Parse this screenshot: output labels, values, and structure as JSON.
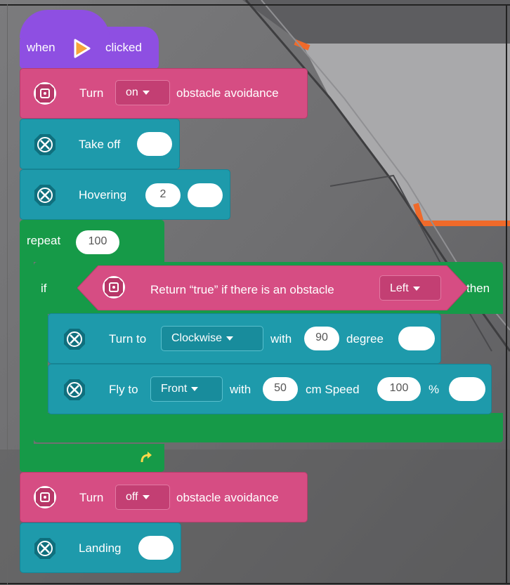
{
  "hat": {
    "when": "when",
    "clicked": "clicked"
  },
  "blocks": {
    "avoid_on": {
      "turn": "Turn",
      "state": "on",
      "suffix": "obstacle avoidance"
    },
    "takeoff": {
      "label": "Take off"
    },
    "hover": {
      "label": "Hovering",
      "value": "2"
    },
    "repeat": {
      "label": "repeat",
      "count": "100"
    },
    "if_block": {
      "if": "if",
      "cond_prefix": "Return “true” if there is an obstacle",
      "direction": "Left",
      "then": "then"
    },
    "turn_to": {
      "label": "Turn to",
      "direction": "Clockwise",
      "with": "with",
      "degrees": "90",
      "unit": "degree"
    },
    "fly_to": {
      "label": "Fly to",
      "direction": "Front",
      "with": "with",
      "distance": "50",
      "unit": "cm Speed",
      "speed": "100",
      "pct": "%"
    },
    "avoid_off": {
      "turn": "Turn",
      "state": "off",
      "suffix": "obstacle avoidance"
    },
    "landing": {
      "label": "Landing"
    }
  },
  "colors": {
    "hat": "#8e4fe2",
    "sensor": "#d64d83",
    "motion": "#1e9aab",
    "control": "#169a48"
  },
  "icons": {
    "flag": "play-flag-icon",
    "sensor": "obstacle-sensor-icon",
    "drone": "drone-icon",
    "loop_arrow": "loop-arrow-icon"
  }
}
